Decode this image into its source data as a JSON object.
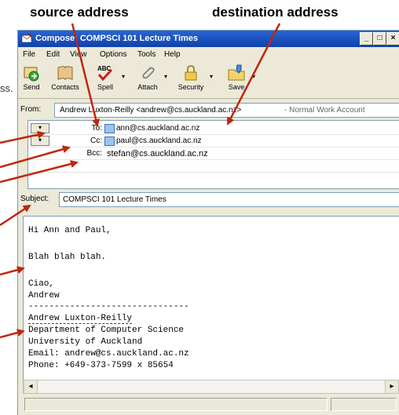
{
  "annotations": {
    "source_address": "source address",
    "destination_address": "destination address",
    "stray_text": "ss."
  },
  "window": {
    "title": "Compose: COMPSCI 101 Lecture Times",
    "controls": [
      "_",
      "□",
      "×"
    ]
  },
  "menu": [
    "File",
    "Edit",
    "View",
    "Options",
    "Tools",
    "Help"
  ],
  "toolbar": [
    {
      "label": "Send",
      "icon": "send-icon"
    },
    {
      "label": "Contacts",
      "icon": "contacts-icon"
    },
    {
      "label": "Spell",
      "icon": "spell-icon"
    },
    {
      "label": "Attach",
      "icon": "attach-icon"
    },
    {
      "label": "Security",
      "icon": "security-icon"
    },
    {
      "label": "Save",
      "icon": "save-icon"
    }
  ],
  "from": {
    "label": "From:",
    "value": "Andrew Luxton-Reilly <andrew@cs.auckland.ac.nz>",
    "account": "- Normal Work Account"
  },
  "recipients": {
    "to_label": "To:",
    "to_value": "ann@cs.auckland.ac.nz",
    "cc_label": "Cc:",
    "cc_value": "paul@cs.auckland.ac.nz",
    "bcc_label": "Bcc:",
    "bcc_value": "stefan@cs.auckland.ac.nz"
  },
  "subject": {
    "label": "Subject:",
    "value": "COMPSCI 101 Lecture Times"
  },
  "body": {
    "greeting": "Hi Ann and Paul,",
    "content": "Blah blah blah.",
    "signoff": "Ciao,",
    "name": "Andrew",
    "separator": "-------------------------------",
    "sig_name": "Andrew Luxton-Reilly",
    "sig_dept": "Department of Computer Science",
    "sig_uni": "University of Auckland",
    "sig_email": "Email: andrew@cs.auckland.ac.nz",
    "sig_phone": "Phone: +649-373-7599 x 85654"
  },
  "colors": {
    "arrow": "#c0260f",
    "titlebar": "#1f56c4"
  }
}
